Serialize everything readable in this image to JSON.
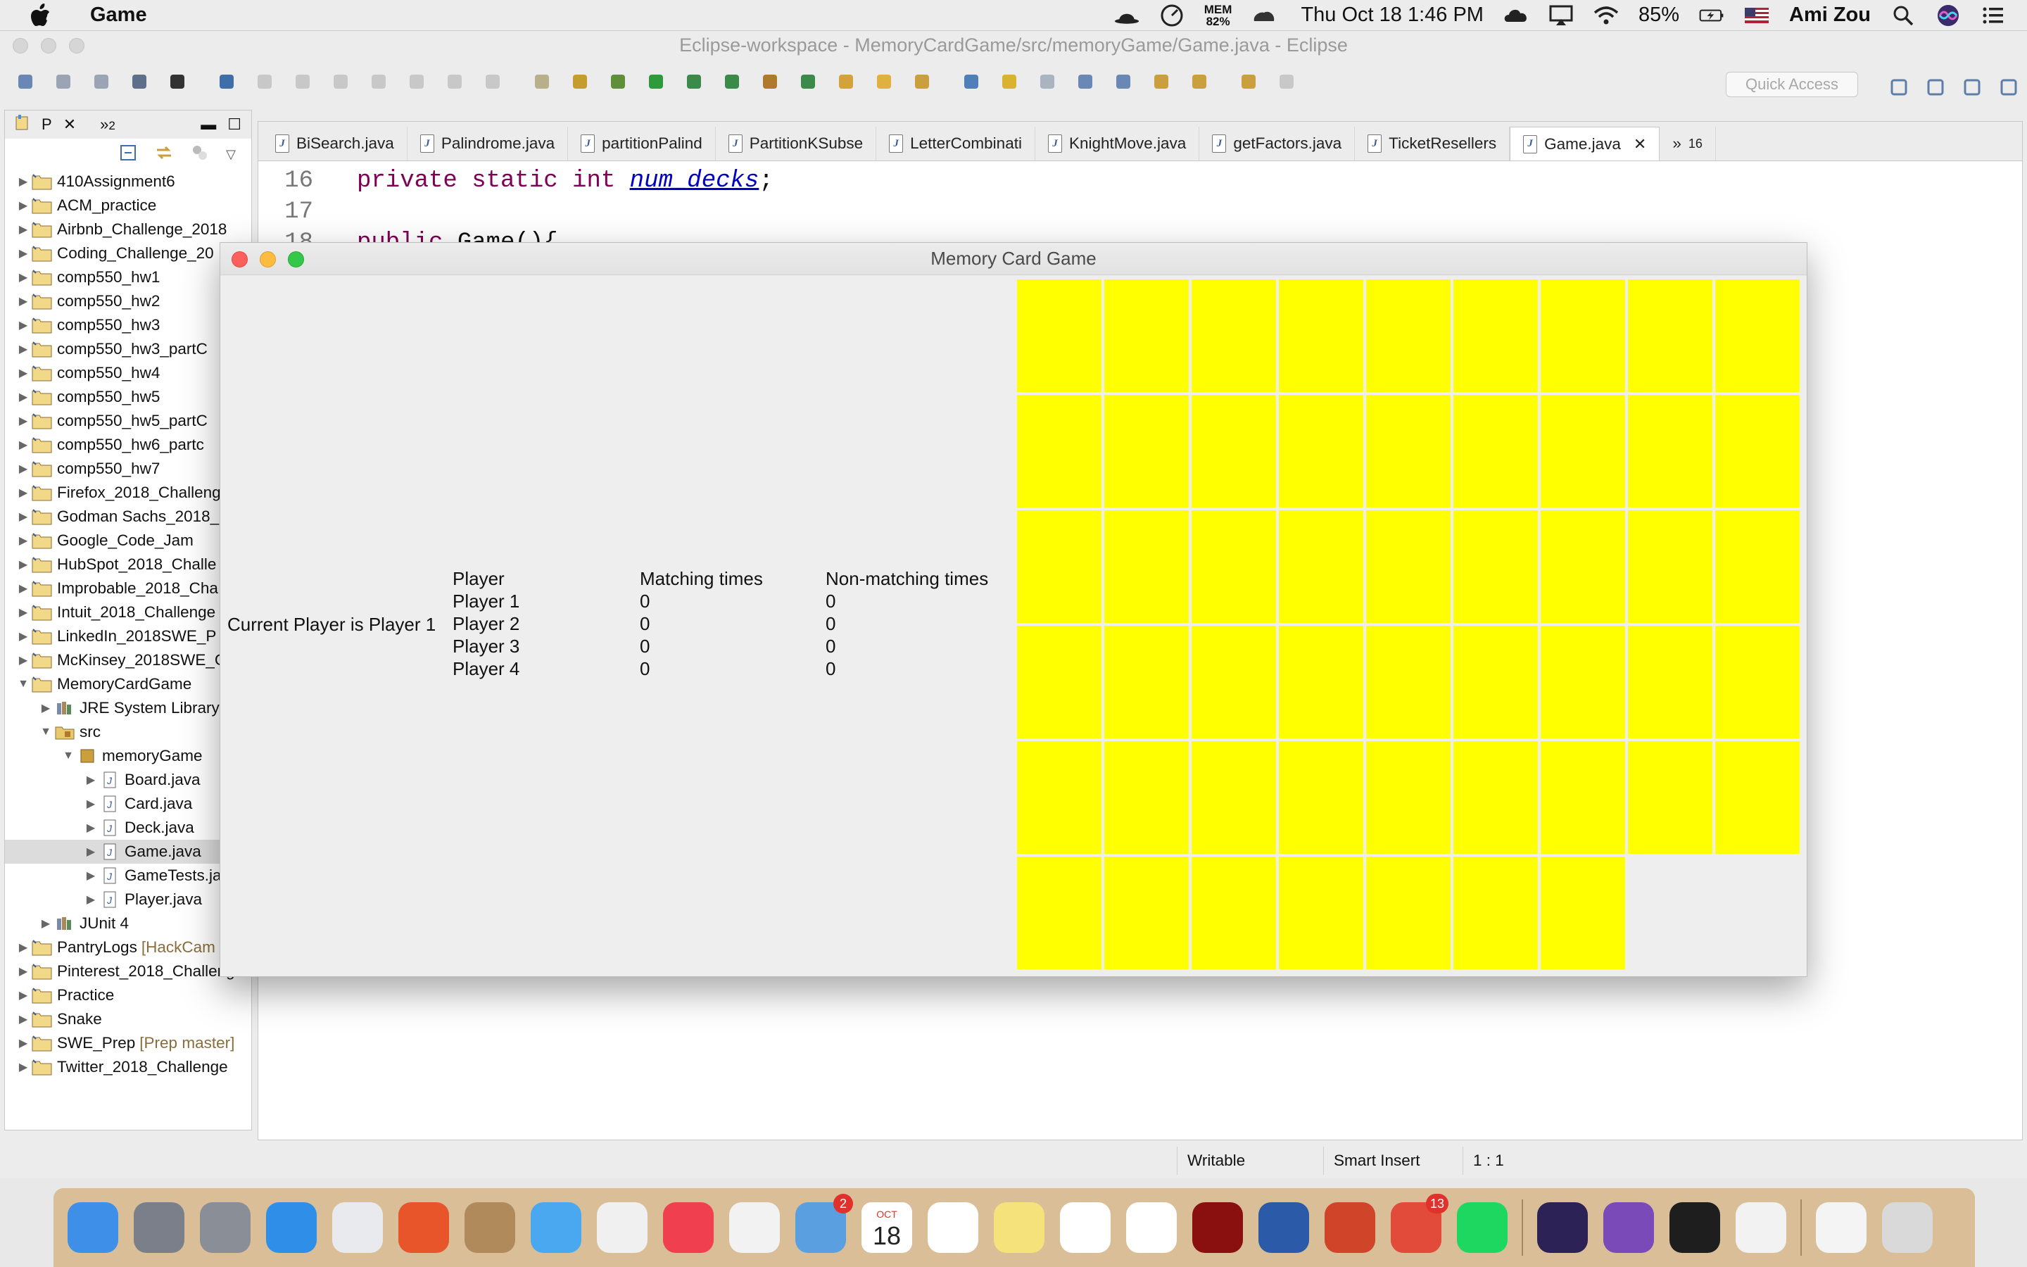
{
  "menubar": {
    "app_name": "Game",
    "mem_label": "MEM",
    "mem_value": "82%",
    "datetime": "Thu Oct 18  1:46 PM",
    "battery": "85%",
    "user": "Ami Zou"
  },
  "eclipse": {
    "window_title": "Eclipse-workspace - MemoryCardGame/src/memoryGame/Game.java - Eclipse",
    "quick_access_placeholder": "Quick Access",
    "package_explorer": {
      "tab_label": "P",
      "overflow_tab": "2",
      "items": [
        {
          "label": "410Assignment6",
          "level": 0,
          "expanded": false
        },
        {
          "label": "ACM_practice",
          "level": 0,
          "expanded": false
        },
        {
          "label": "Airbnb_Challenge_2018",
          "level": 0,
          "expanded": false
        },
        {
          "label": "Coding_Challenge_20",
          "level": 0,
          "expanded": false
        },
        {
          "label": "comp550_hw1",
          "level": 0,
          "expanded": false
        },
        {
          "label": "comp550_hw2",
          "level": 0,
          "expanded": false
        },
        {
          "label": "comp550_hw3",
          "level": 0,
          "expanded": false
        },
        {
          "label": "comp550_hw3_partC",
          "level": 0,
          "expanded": false
        },
        {
          "label": "comp550_hw4",
          "level": 0,
          "expanded": false
        },
        {
          "label": "comp550_hw5",
          "level": 0,
          "expanded": false
        },
        {
          "label": "comp550_hw5_partC",
          "level": 0,
          "expanded": false
        },
        {
          "label": "comp550_hw6_partc",
          "level": 0,
          "expanded": false
        },
        {
          "label": "comp550_hw7",
          "level": 0,
          "expanded": false
        },
        {
          "label": "Firefox_2018_Challeng",
          "level": 0,
          "expanded": false
        },
        {
          "label": "Godman Sachs_2018_",
          "level": 0,
          "expanded": false
        },
        {
          "label": "Google_Code_Jam",
          "level": 0,
          "expanded": false
        },
        {
          "label": "HubSpot_2018_Challe",
          "level": 0,
          "expanded": false
        },
        {
          "label": "Improbable_2018_Cha",
          "level": 0,
          "expanded": false
        },
        {
          "label": "Intuit_2018_Challenge",
          "level": 0,
          "expanded": false
        },
        {
          "label": "LinkedIn_2018SWE_P",
          "level": 0,
          "expanded": false
        },
        {
          "label": "McKinsey_2018SWE_C",
          "level": 0,
          "expanded": false
        },
        {
          "label": "MemoryCardGame",
          "level": 0,
          "expanded": true
        },
        {
          "label": "JRE System Library",
          "level": 1,
          "expanded": false
        },
        {
          "label": "src",
          "level": 1,
          "expanded": true
        },
        {
          "label": "memoryGame",
          "level": 2,
          "expanded": true
        },
        {
          "label": "Board.java",
          "level": 3,
          "expanded": false
        },
        {
          "label": "Card.java",
          "level": 3,
          "expanded": false
        },
        {
          "label": "Deck.java",
          "level": 3,
          "expanded": false
        },
        {
          "label": "Game.java",
          "level": 3,
          "expanded": false,
          "selected": true
        },
        {
          "label": "GameTests.ja",
          "level": 3,
          "expanded": false
        },
        {
          "label": "Player.java",
          "level": 3,
          "expanded": false
        },
        {
          "label": "JUnit 4",
          "level": 1,
          "expanded": false
        },
        {
          "label": "PantryLogs",
          "repo": "[HackCam",
          "level": 0,
          "expanded": false
        },
        {
          "label": "Pinterest_2018_Challenge",
          "level": 0,
          "expanded": false
        },
        {
          "label": "Practice",
          "level": 0,
          "expanded": false
        },
        {
          "label": "Snake",
          "level": 0,
          "expanded": false
        },
        {
          "label": "SWE_Prep",
          "repo": "[Prep master]",
          "level": 0,
          "expanded": false
        },
        {
          "label": "Twitter_2018_Challenge",
          "level": 0,
          "expanded": false
        }
      ]
    },
    "editor_tabs": [
      {
        "label": "BiSearch.java"
      },
      {
        "label": "Palindrome.java"
      },
      {
        "label": "partitionPalind"
      },
      {
        "label": "PartitionKSubse"
      },
      {
        "label": "LetterCombinati"
      },
      {
        "label": "KnightMove.java"
      },
      {
        "label": "getFactors.java"
      },
      {
        "label": "TicketResellers"
      },
      {
        "label": "Game.java",
        "active": true
      }
    ],
    "overflow_tabs": "16",
    "code_lines": [
      {
        "num": "16",
        "kw": "private static int",
        "ident": "num_decks",
        "rest": ";"
      },
      {
        "num": "17",
        "kw": "",
        "ident": "",
        "rest": ""
      },
      {
        "num": "18",
        "kw": "public",
        "ident": "",
        "rest": "Game(){"
      }
    ],
    "status": {
      "mode": "Writable",
      "insert": "Smart Insert",
      "position": "1 : 1"
    }
  },
  "game_window": {
    "title": "Memory Card Game",
    "current_player": "Current Player is Player 1",
    "score_headers": [
      "Player",
      "Matching times",
      "Non-matching times"
    ],
    "scores": [
      {
        "player": "Player 1",
        "matching": "0",
        "nonmatching": "0"
      },
      {
        "player": "Player 2",
        "matching": "0",
        "nonmatching": "0"
      },
      {
        "player": "Player 3",
        "matching": "0",
        "nonmatching": "0"
      },
      {
        "player": "Player 4",
        "matching": "0",
        "nonmatching": "0"
      }
    ],
    "card_back_color": "#ffff00",
    "board": {
      "columns": 9,
      "full_rows": 5,
      "last_row_cards": 7,
      "total_cards": 52
    }
  },
  "dock": {
    "apps": [
      {
        "name": "finder-icon"
      },
      {
        "name": "launchpad-icon"
      },
      {
        "name": "system-preferences-icon"
      },
      {
        "name": "safari-icon"
      },
      {
        "name": "chrome-icon"
      },
      {
        "name": "firefox-icon"
      },
      {
        "name": "contacts-icon"
      },
      {
        "name": "messages-icon"
      },
      {
        "name": "wechat-icon"
      },
      {
        "name": "news-icon"
      },
      {
        "name": "scrivener-icon"
      },
      {
        "name": "mail-icon",
        "badge": "2"
      },
      {
        "name": "calendar-icon",
        "month": "OCT",
        "day": "18"
      },
      {
        "name": "photos-icon"
      },
      {
        "name": "notes-icon"
      },
      {
        "name": "reminders-icon"
      },
      {
        "name": "evernote-icon"
      },
      {
        "name": "acrobat-icon"
      },
      {
        "name": "word-icon"
      },
      {
        "name": "powerpoint-icon"
      },
      {
        "name": "todoist-icon",
        "badge": "13"
      },
      {
        "name": "spotify-icon"
      },
      {
        "name": "eclipse-icon"
      },
      {
        "name": "github-desktop-icon"
      },
      {
        "name": "terminal-icon"
      },
      {
        "name": "java-icon"
      },
      {
        "name": "documents-icon"
      },
      {
        "name": "trash-icon"
      }
    ]
  }
}
